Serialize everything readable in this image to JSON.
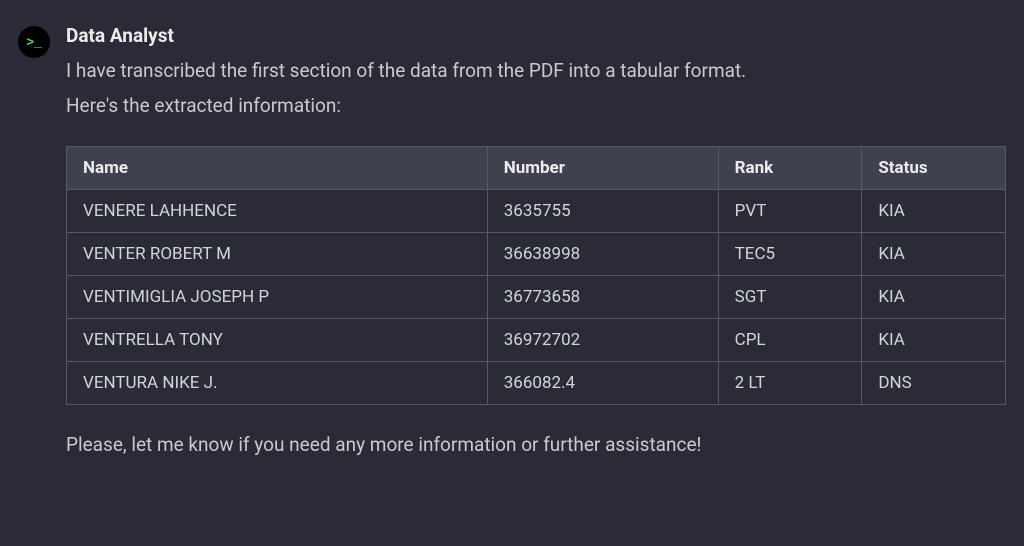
{
  "assistant": {
    "name": "Data Analyst",
    "avatar_glyph": ">_"
  },
  "message": {
    "intro_line1": "I have transcribed the first section of the data from the PDF into a tabular format.",
    "intro_line2": "Here's the extracted information:",
    "outro": "Please, let me know if you need any more information or further assistance!"
  },
  "table": {
    "headers": {
      "name": "Name",
      "number": "Number",
      "rank": "Rank",
      "status": "Status"
    },
    "rows": [
      {
        "name": "VENERE LAHHENCE",
        "number": "3635755",
        "rank": "PVT",
        "status": "KIA"
      },
      {
        "name": "VENTER ROBERT M",
        "number": "36638998",
        "rank": "TEC5",
        "status": "KIA"
      },
      {
        "name": "VENTIMIGLIA JOSEPH P",
        "number": "36773658",
        "rank": "SGT",
        "status": "KIA"
      },
      {
        "name": "VENTRELLA TONY",
        "number": "36972702",
        "rank": "CPL",
        "status": "KIA"
      },
      {
        "name": "VENTURA NIKE J.",
        "number": "366082.4",
        "rank": "2 LT",
        "status": "DNS"
      }
    ]
  }
}
